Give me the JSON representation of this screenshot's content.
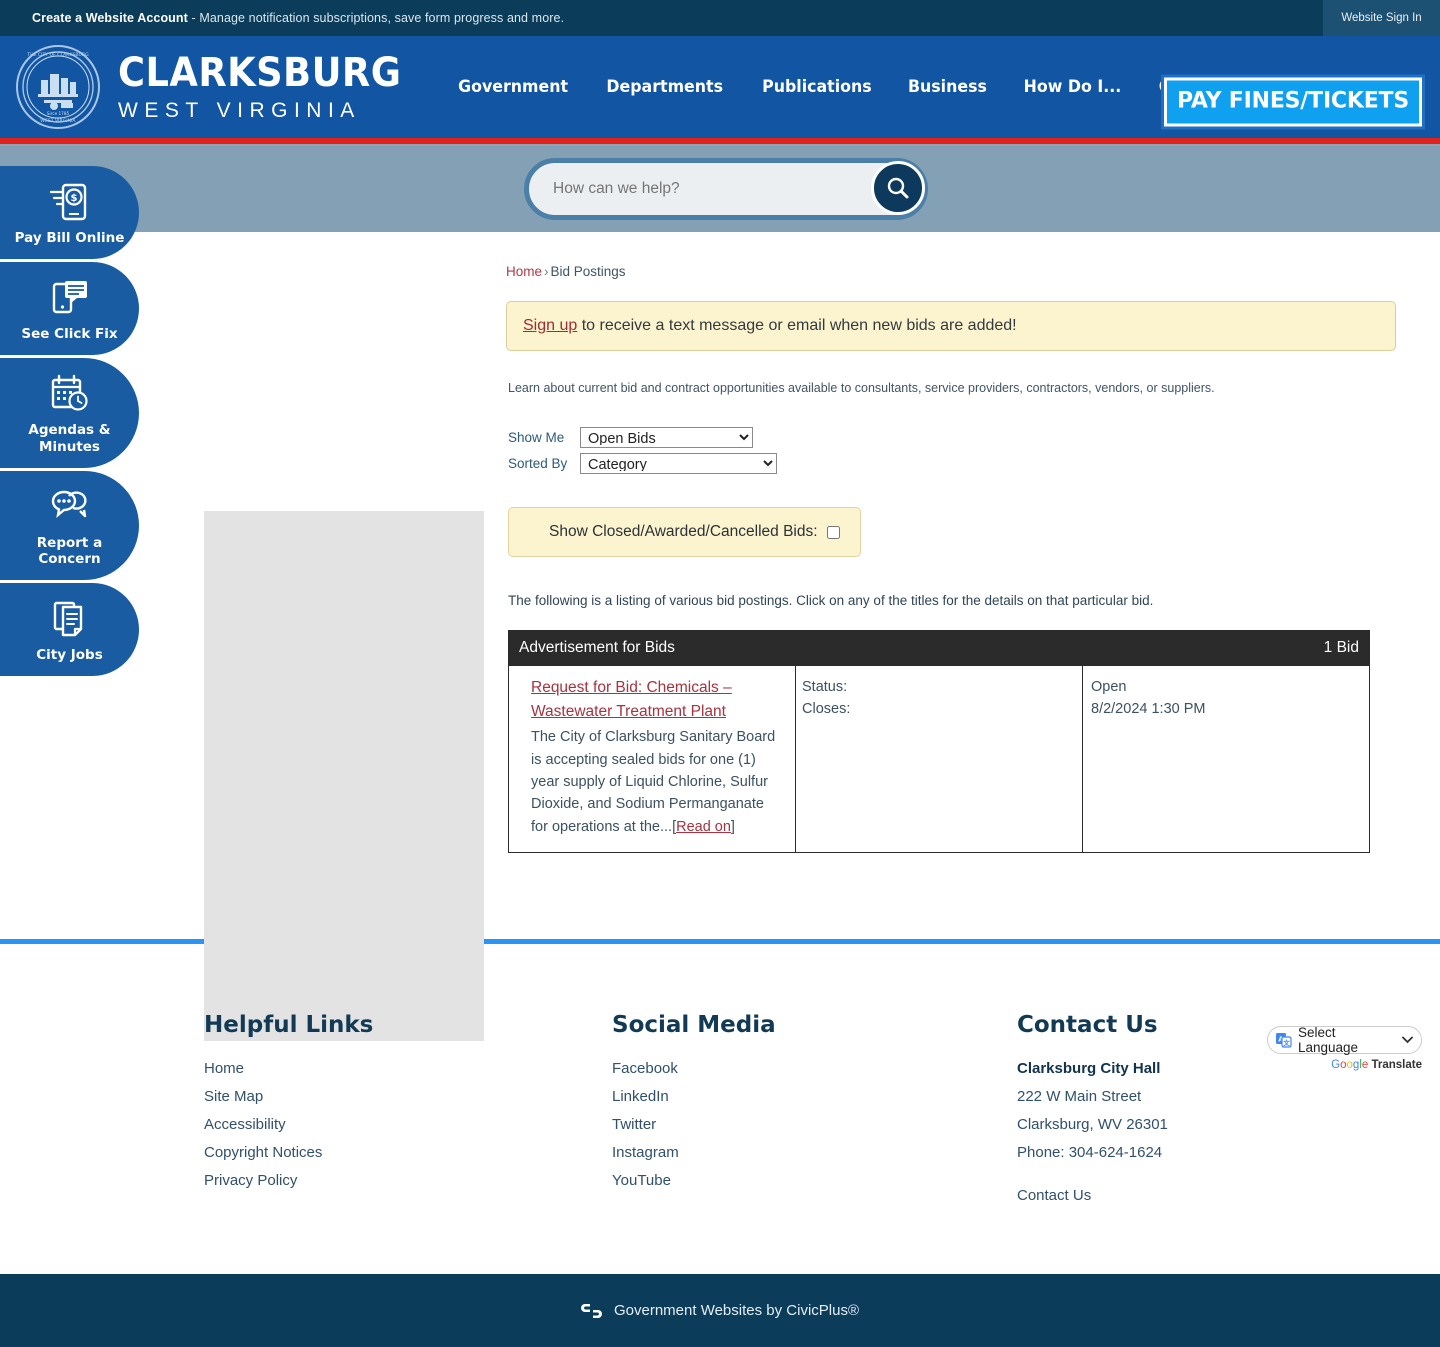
{
  "topbar": {
    "account_link": "Create a Website Account",
    "account_desc": " - Manage notification subscriptions, save form progress and more.",
    "signin": "Website Sign In"
  },
  "header": {
    "brand_main": "CLARKSBURG",
    "brand_sub": "WEST VIRGINIA",
    "nav": [
      {
        "label": "Government"
      },
      {
        "label": "Departments"
      },
      {
        "label": "Publications"
      },
      {
        "label": "Business"
      },
      {
        "label": "How Do I..."
      },
      {
        "label": "Community"
      }
    ],
    "pay_button": "PAY FINES/TICKETS"
  },
  "search": {
    "placeholder": "How can we help?",
    "value": ""
  },
  "quicklinks": [
    {
      "label": "Pay Bill Online",
      "icon": "mobile-payment-icon"
    },
    {
      "label": "See Click Fix",
      "icon": "mobile-report-icon"
    },
    {
      "label": "Agendas & Minutes",
      "icon": "calendar-clock-icon"
    },
    {
      "label": "Report a Concern",
      "icon": "chat-bubbles-icon"
    },
    {
      "label": "City Jobs",
      "icon": "documents-icon"
    }
  ],
  "breadcrumb": {
    "home": "Home",
    "separator": "›",
    "current": "Bid Postings"
  },
  "notice": {
    "link": "Sign up",
    "text": " to receive a text message or email when new bids are added!"
  },
  "intro": "Learn about current bid and contract opportunities available to consultants, service providers, contractors, vendors, or suppliers.",
  "filters": {
    "show_me_label": "Show Me",
    "show_me_value": "Open Bids",
    "show_me_options": [
      "Open Bids"
    ],
    "sorted_by_label": "Sorted By",
    "sorted_by_value": "Category",
    "sorted_by_options": [
      "Category"
    ],
    "closed_label": "Show Closed/Awarded/Cancelled Bids:",
    "closed_checked": false
  },
  "listing_note": "The following is a listing of various bid postings. Click on any of the titles for the details on that particular bid.",
  "bid_table": {
    "header_title": "Advertisement for Bids",
    "header_count": "1 Bid",
    "status_label": "Status:",
    "closes_label": "Closes:",
    "rows": [
      {
        "title": "Request for Bid: Chemicals – Wastewater Treatment Plant",
        "description": "The City of Clarksburg Sanitary Board is accepting sealed bids for one (1) year supply of Liquid Chlorine, Sulfur Dioxide, and Sodium Permanganate for operations at the...",
        "read_on": "Read on",
        "status": "Open",
        "closes": "8/2/2024 1:30 PM"
      }
    ]
  },
  "footer": {
    "helpful": {
      "heading": "Helpful Links",
      "links": [
        "Home",
        "Site Map",
        "Accessibility",
        "Copyright Notices",
        "Privacy Policy"
      ]
    },
    "social": {
      "heading": "Social Media",
      "links": [
        "Facebook",
        "LinkedIn",
        "Twitter",
        "Instagram",
        "YouTube"
      ]
    },
    "contact": {
      "heading": "Contact Us",
      "name": "Clarksburg City Hall",
      "address1": "222 W Main Street",
      "address2": "Clarksburg, WV 26301",
      "phone": "Phone: 304-624-1624",
      "contact_link": "Contact Us"
    },
    "translate": {
      "label": "Select Language",
      "attribution": "Translate",
      "google": "Google"
    }
  },
  "bottombar": {
    "text": "Government Websites by CivicPlus®"
  },
  "colors": {
    "navy": "#0b3c5a",
    "header_blue": "#1155a3",
    "red_stripe": "#e0211c",
    "search_band": "#84a0b4",
    "accent_cyan": "#0fa0f0",
    "quicklink_blue": "#1a5ca2",
    "notice_bg": "#fbf4ce",
    "link_red": "#a8323f",
    "footer_divider": "#2b95f3",
    "table_header": "#2b2b2b"
  }
}
